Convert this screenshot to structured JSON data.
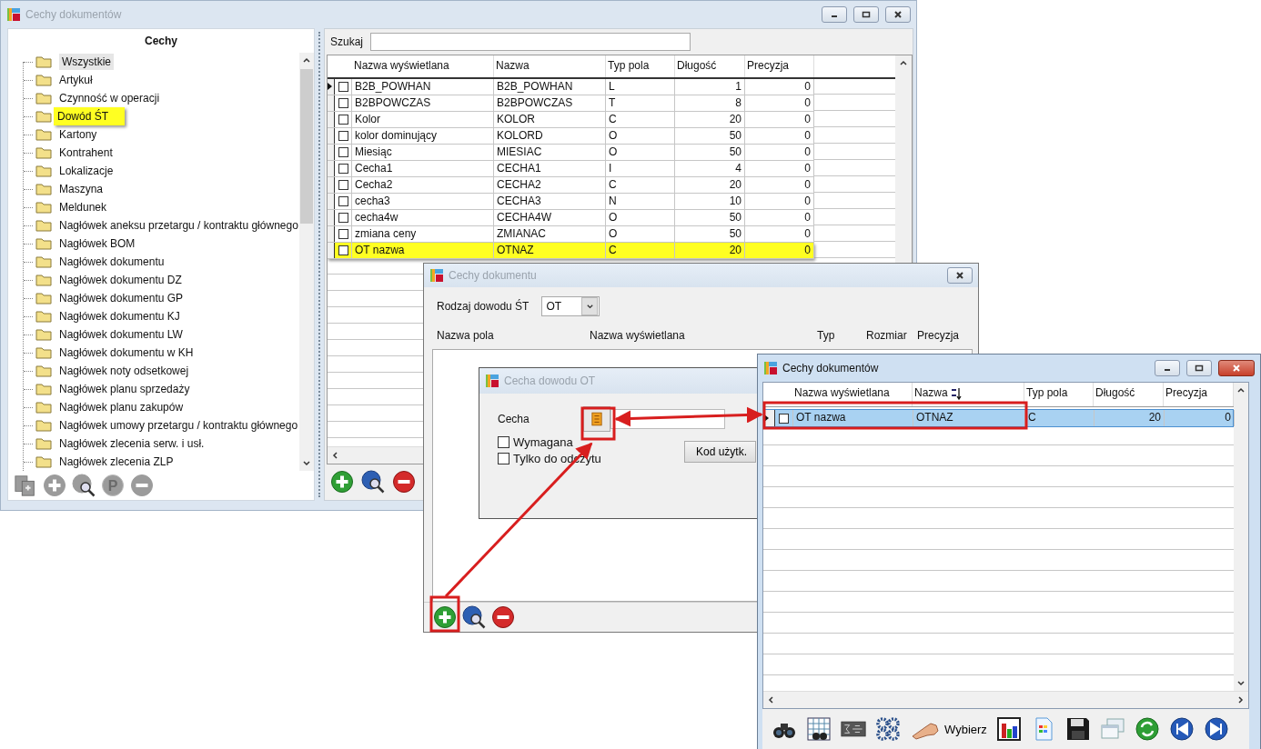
{
  "main_window": {
    "title": "Cechy dokumentów",
    "active": false,
    "tree": {
      "header": "Cechy",
      "items": [
        {
          "label": "Wszystkie",
          "selected": true,
          "highlighted": false
        },
        {
          "label": "Artykuł",
          "selected": false,
          "highlighted": false
        },
        {
          "label": "Czynność w operacji",
          "selected": false,
          "highlighted": false
        },
        {
          "label": "Dowód ŚT",
          "selected": false,
          "highlighted": true
        },
        {
          "label": "Kartony",
          "selected": false,
          "highlighted": false
        },
        {
          "label": "Kontrahent",
          "selected": false,
          "highlighted": false
        },
        {
          "label": "Lokalizacje",
          "selected": false,
          "highlighted": false
        },
        {
          "label": "Maszyna",
          "selected": false,
          "highlighted": false
        },
        {
          "label": "Meldunek",
          "selected": false,
          "highlighted": false
        },
        {
          "label": "Nagłówek aneksu przetargu / kontraktu głównego",
          "selected": false,
          "highlighted": false
        },
        {
          "label": "Nagłówek BOM",
          "selected": false,
          "highlighted": false
        },
        {
          "label": "Nagłówek dokumentu",
          "selected": false,
          "highlighted": false
        },
        {
          "label": "Nagłówek dokumentu DZ",
          "selected": false,
          "highlighted": false
        },
        {
          "label": "Nagłówek dokumentu GP",
          "selected": false,
          "highlighted": false
        },
        {
          "label": "Nagłówek dokumentu KJ",
          "selected": false,
          "highlighted": false
        },
        {
          "label": "Nagłówek dokumentu LW",
          "selected": false,
          "highlighted": false
        },
        {
          "label": "Nagłówek dokumentu w KH",
          "selected": false,
          "highlighted": false
        },
        {
          "label": "Nagłówek noty odsetkowej",
          "selected": false,
          "highlighted": false
        },
        {
          "label": "Nagłówek planu sprzedaży",
          "selected": false,
          "highlighted": false
        },
        {
          "label": "Nagłówek planu zakupów",
          "selected": false,
          "highlighted": false
        },
        {
          "label": "Nagłówek umowy przetargu / kontraktu głównego",
          "selected": false,
          "highlighted": false
        },
        {
          "label": "Nagłówek zlecenia serw. i usł.",
          "selected": false,
          "highlighted": false
        },
        {
          "label": "Nagłówek zlecenia ZLP",
          "selected": false,
          "highlighted": false
        }
      ]
    },
    "tree_toolbar": [
      {
        "kind": "copy",
        "disabled": true
      },
      {
        "kind": "add",
        "disabled": true
      },
      {
        "kind": "preview",
        "disabled": true
      },
      {
        "kind": "print",
        "glyph": "P",
        "disabled": true
      },
      {
        "kind": "delete",
        "disabled": true
      }
    ],
    "search": {
      "label": "Szukaj"
    },
    "table": {
      "columns": [
        "Nazwa wyświetlana",
        "Nazwa",
        "Typ pola",
        "Długość",
        "Precyzja"
      ],
      "rows": [
        {
          "current": true,
          "checked": false,
          "highlighted": false,
          "cells": [
            "B2B_POWHAN",
            "B2B_POWHAN",
            "L",
            "1",
            "0"
          ]
        },
        {
          "current": false,
          "checked": false,
          "highlighted": false,
          "cells": [
            "B2BPOWCZAS",
            "B2BPOWCZAS",
            "T",
            "8",
            "0"
          ]
        },
        {
          "current": false,
          "checked": false,
          "highlighted": false,
          "cells": [
            "Kolor",
            "KOLOR",
            "C",
            "20",
            "0"
          ]
        },
        {
          "current": false,
          "checked": false,
          "highlighted": false,
          "cells": [
            "kolor dominujący",
            "KOLORD",
            "O",
            "50",
            "0"
          ]
        },
        {
          "current": false,
          "checked": false,
          "highlighted": false,
          "cells": [
            "Miesiąc",
            "MIESIAC",
            "O",
            "50",
            "0"
          ]
        },
        {
          "current": false,
          "checked": false,
          "highlighted": false,
          "cells": [
            "Cecha1",
            "CECHA1",
            "I",
            "4",
            "0"
          ]
        },
        {
          "current": false,
          "checked": false,
          "highlighted": false,
          "cells": [
            "Cecha2",
            "CECHA2",
            "C",
            "20",
            "0"
          ]
        },
        {
          "current": false,
          "checked": false,
          "highlighted": false,
          "cells": [
            "cecha3",
            "CECHA3",
            "N",
            "10",
            "0"
          ]
        },
        {
          "current": false,
          "checked": false,
          "highlighted": false,
          "cells": [
            "cecha4w",
            "CECHA4W",
            "O",
            "50",
            "0"
          ]
        },
        {
          "current": false,
          "checked": false,
          "highlighted": false,
          "cells": [
            "zmiana ceny",
            "ZMIANAC",
            "O",
            "50",
            "0"
          ]
        },
        {
          "current": false,
          "checked": false,
          "highlighted": true,
          "cells": [
            "OT nazwa",
            "OTNAZ",
            "C",
            "20",
            "0"
          ]
        }
      ]
    },
    "toolbar": [
      {
        "kind": "add",
        "disabled": false
      },
      {
        "kind": "preview",
        "disabled": false
      },
      {
        "kind": "delete",
        "disabled": false
      }
    ]
  },
  "dialog": {
    "title": "Cechy dokumentu",
    "active": false,
    "type_label": "Rodzaj dowodu ŚT",
    "type_value": "OT",
    "columns": [
      "Nazwa pola",
      "Nazwa wyświetlana",
      "Typ",
      "Rozmiar",
      "Precyzja"
    ],
    "toolbar": [
      {
        "kind": "add",
        "disabled": false
      },
      {
        "kind": "preview",
        "disabled": false
      },
      {
        "kind": "delete",
        "disabled": false
      }
    ]
  },
  "feature_dialog": {
    "title": "Cecha dowodu OT",
    "active": false,
    "field_label": "Cecha",
    "checkboxes": [
      {
        "label": "Wymagana",
        "checked": false
      },
      {
        "label": "Tylko do odczytu",
        "checked": false
      }
    ],
    "button": "Kod użytk."
  },
  "picker_window": {
    "title": "Cechy dokumentów",
    "active": true,
    "columns": [
      {
        "label": "Nazwa wyświetlana",
        "sorted": false
      },
      {
        "label": "Nazwa",
        "sorted": true
      },
      {
        "label": "Typ pola",
        "sorted": false
      },
      {
        "label": "Długość",
        "sorted": false
      },
      {
        "label": "Precyzja",
        "sorted": false
      }
    ],
    "rows": [
      {
        "current": true,
        "checked": false,
        "selected": true,
        "cells": [
          "OT nazwa",
          "OTNAZ",
          "C",
          "20",
          "0"
        ]
      }
    ],
    "toolbar": [
      {
        "kind": "binoculars"
      },
      {
        "kind": "grid-search"
      },
      {
        "kind": "formula"
      },
      {
        "kind": "gears"
      },
      {
        "kind": "pick",
        "label": "Wybierz"
      },
      {
        "kind": "chart"
      },
      {
        "kind": "document"
      },
      {
        "kind": "save"
      },
      {
        "kind": "windows"
      },
      {
        "kind": "refresh"
      },
      {
        "kind": "first"
      },
      {
        "kind": "last"
      }
    ]
  }
}
